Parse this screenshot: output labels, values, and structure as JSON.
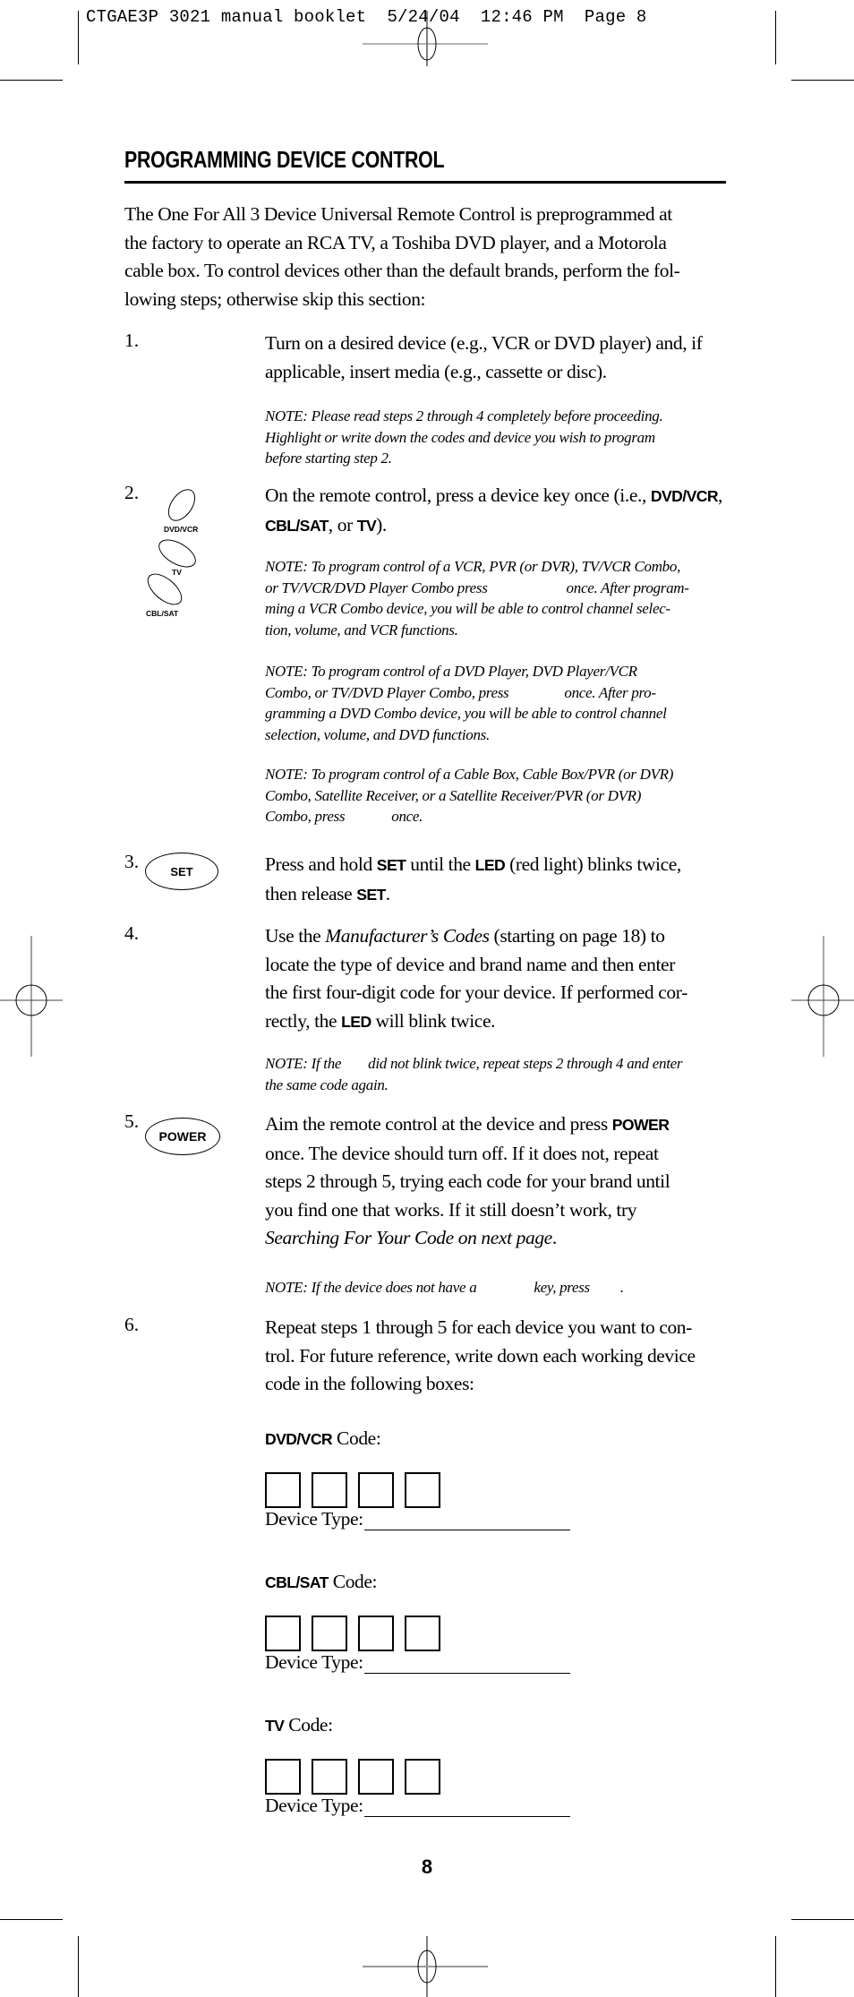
{
  "print_header": {
    "slug": "CTGAE3P 3021 manual booklet  5/24/04  12:46 PM  Page 8"
  },
  "title": "PROGRAMMING DEVICE CONTROL",
  "intro_lines": [
    "The One For All 3 Device Universal Remote Control is preprogrammed at",
    "the factory to operate an RCA TV,  a Toshiba DVD player, and a Motorola",
    "cable box. To control devices other than the default brands, perform the fol-",
    "lowing steps; otherwise skip this section:"
  ],
  "steps": {
    "s1": {
      "number": "1.",
      "lines": [
        "Turn on a desired device (e.g., VCR or DVD player) and, if",
        "applicable,  insert media (e.g., cassette or disc)."
      ],
      "note_lines": [
        "NOTE: Please read steps 2 through 4 completely before proceeding.",
        "Highlight or write down the codes and device you wish to program",
        "before starting step 2."
      ]
    },
    "s2": {
      "number": "2.",
      "line1_pre": "On the remote control, press a device key once (i.e., ",
      "key_dvdvcr": "DVD/VCR",
      "line1_post": ",",
      "key_cblsat": "CBL/SAT",
      "line2_mid": ", or ",
      "key_tv": "TV",
      "line2_post": ").",
      "icon_keys": [
        "DVD/VCR",
        "TV",
        "CBL/SAT"
      ],
      "note_vcr_lines": [
        "NOTE: To program control of a VCR, PVR (or DVR), TV/VCR Combo,",
        "or TV/VCR/DVD Player Combo press",
        "once. After program-",
        "ming a VCR Combo device, you will be able to control channel selec-",
        "tion, volume, and VCR functions."
      ],
      "note_dvd_lines": [
        "NOTE: To program control of a DVD Player, DVD Player/VCR",
        "Combo, or TV/DVD Player Combo, press",
        "once. After pro-",
        "gramming a DVD Combo device, you will be able to control channel",
        "selection, volume, and DVD functions."
      ],
      "note_cbl_lines": [
        "NOTE: To program control of a Cable Box, Cable Box/PVR (or DVR)",
        "Combo, Satellite Receiver, or a Satellite Receiver/PVR (or DVR)",
        "Combo, press",
        "once."
      ]
    },
    "s3": {
      "number": "3.",
      "icon_label": "SET",
      "l1_pre": "Press and hold ",
      "l1_set": "SET",
      "l1_mid": " until the ",
      "l1_led": "LED",
      "l1_post": " (red light) blinks twice,",
      "l2_pre": "then release ",
      "l2_set": "SET",
      "l2_post": "."
    },
    "s4": {
      "number": "4.",
      "l1_pre": "Use the ",
      "l1_italic": "Manufacturer’s Codes",
      "l1_post": " (starting on page 18) to",
      "l2": "locate the type of device and brand name and then enter",
      "l3": "the first four-digit code for your device. If performed cor-",
      "l4_pre": "rectly, the ",
      "l4_led": "LED",
      "l4_post": " will blink twice.",
      "note_pre": "NOTE: If the",
      "note_post": "did not blink twice, repeat steps 2 through 4 and enter",
      "note_l2": "the same code again."
    },
    "s5": {
      "number": "5.",
      "icon_label": "POWER",
      "l1_pre": "Aim the remote control at the device and press ",
      "l1_power": "POWER",
      "l2": "once. The device should turn off. If it does not, repeat",
      "l3": "steps 2 through 5, trying each code for your brand until",
      "l4": "you find one that works. If it still doesn’t work, try",
      "l5_italic": "Searching For Your Code on next page",
      "l5_post": ".",
      "note_pre": "NOTE: If the device does not have a",
      "note_mid": "key, press",
      "note_post": "."
    },
    "s6": {
      "number": "6.",
      "lines": [
        "Repeat steps 1 through 5 for each device you want to con-",
        "trol. For future reference, write down each working device",
        "code in the following boxes:"
      ]
    }
  },
  "code_entries": [
    {
      "key": "DVD/VCR",
      "suffix": " Code:",
      "device_type_label": "Device Type:",
      "digits": [
        "",
        "",
        "",
        ""
      ]
    },
    {
      "key": "CBL/SAT",
      "suffix": " Code:",
      "device_type_label": "Device Type:",
      "digits": [
        "",
        "",
        "",
        ""
      ]
    },
    {
      "key": "TV",
      "suffix": " Code:",
      "device_type_label": "Device Type:",
      "digits": [
        "",
        "",
        "",
        ""
      ]
    }
  ],
  "page_number": "8"
}
